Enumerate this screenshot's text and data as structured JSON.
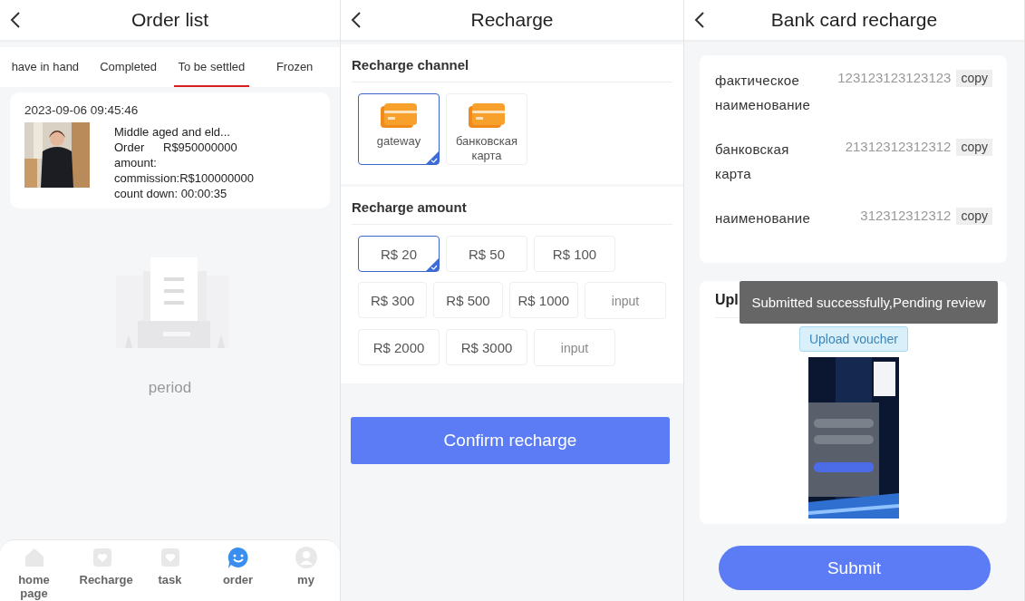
{
  "order_list": {
    "title": "Order list",
    "tabs": [
      {
        "label": "have in hand",
        "selected": false
      },
      {
        "label": "Completed",
        "selected": false
      },
      {
        "label": "To be settled",
        "selected": true
      },
      {
        "label": "Frozen",
        "selected": false
      }
    ],
    "orders": [
      {
        "time": "2023-09-06 09:45:46",
        "name": "Middle aged and eld...",
        "order_amount_label": "Order amount:",
        "order_amount": "R$950000000",
        "commission": "commission:R$100000000",
        "count_down": "count down:  00:00:35"
      }
    ],
    "empty_text": "period",
    "nav": [
      {
        "label": "home page",
        "kind": "home",
        "selected": false
      },
      {
        "label": "Recharge",
        "kind": "card",
        "selected": false
      },
      {
        "label": "task",
        "kind": "card",
        "selected": false
      },
      {
        "label": "order",
        "kind": "chat",
        "selected": true
      },
      {
        "label": "my",
        "kind": "user",
        "selected": false
      }
    ]
  },
  "recharge": {
    "title": "Recharge",
    "channel_title": "Recharge channel",
    "channels": [
      {
        "label": "gateway",
        "selected": true
      },
      {
        "label": "банковская карта",
        "selected": false
      }
    ],
    "amount_title": "Recharge amount",
    "amount_rows": [
      [
        {
          "kind": "amount",
          "label": "R$ 20",
          "selected": true
        },
        {
          "kind": "amount",
          "label": "R$ 50",
          "selected": false
        },
        {
          "kind": "amount",
          "label": "R$ 100",
          "selected": false
        }
      ],
      [
        {
          "kind": "amount",
          "label": "R$ 300",
          "selected": false
        },
        {
          "kind": "amount",
          "label": "R$ 500",
          "selected": false
        },
        {
          "kind": "amount",
          "label": "R$ 1000",
          "selected": false
        },
        {
          "kind": "input",
          "placeholder": "input"
        }
      ],
      [
        {
          "kind": "amount",
          "label": "R$ 2000",
          "selected": false
        },
        {
          "kind": "amount",
          "label": "R$ 3000",
          "selected": false
        },
        {
          "kind": "input",
          "placeholder": "input"
        }
      ]
    ],
    "confirm": "Confirm recharge"
  },
  "bank": {
    "title": "Bank card recharge",
    "rows": [
      {
        "label": "фактическое наименование",
        "value": "123123123123123",
        "copy": "copy"
      },
      {
        "label": "банковская карта",
        "value": "21312312312312",
        "copy": "copy"
      },
      {
        "label": "наименование",
        "value": "312312312312",
        "copy": "copy"
      }
    ],
    "upload_title": "Upl",
    "toast": "Submitted successfully,Pending review",
    "upload_button": "Upload voucher",
    "submit": "Submit"
  }
}
